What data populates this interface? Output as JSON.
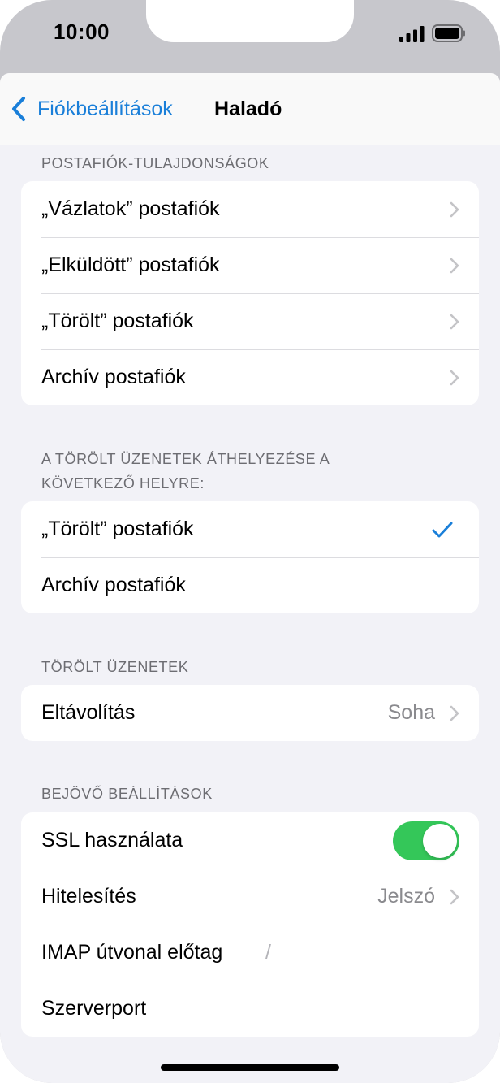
{
  "status_bar": {
    "time": "10:00"
  },
  "navbar": {
    "back_label": "Fiókbeállítások",
    "title": "Haladó"
  },
  "sections": {
    "mailbox_props": {
      "header": "POSTAFIÓK-TULAJDONSÁGOK",
      "rows": [
        "„Vázlatok” postafiók",
        "„Elküldött” postafiók",
        "„Törölt” postafiók",
        "Archív postafiók"
      ]
    },
    "move_deleted": {
      "header_line1": "A TÖRÖLT ÜZENETEK ÁTHELYEZÉSE A",
      "header_line2": "KÖVETKEZŐ HELYRE:",
      "rows": [
        "„Törölt” postafiók",
        "Archív postafiók"
      ],
      "selected": "„Törölt” postafiók"
    },
    "deleted_messages": {
      "header": "TÖRÖLT ÜZENETEK",
      "remove_label": "Eltávolítás",
      "remove_value": "Soha"
    },
    "incoming": {
      "header": "BEJÖVŐ BEÁLLÍTÁSOK",
      "ssl_label": "SSL használata",
      "ssl_enabled": true,
      "auth_label": "Hitelesítés",
      "auth_value": "Jelszó",
      "imap_label": "IMAP útvonal előtag",
      "imap_value": "/",
      "port_label": "Szerverport"
    }
  },
  "colors": {
    "accent": "#1a7fd9",
    "toggle_on": "#34c759",
    "background": "#f2f2f7"
  }
}
